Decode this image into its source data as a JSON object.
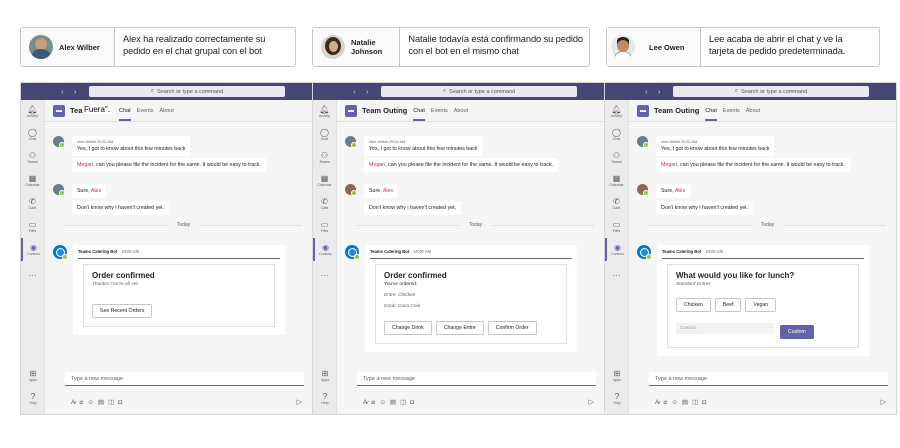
{
  "captions": [
    {
      "name": "Alex Wilber",
      "text_line1": "Alex ha realizado correctamente su",
      "text_line2": "pedido en el chat grupal con el bot"
    },
    {
      "name_line1": "Natalie",
      "name_line2": "Johnson",
      "text_line1": "Natalie todavía está confirmando su pedido",
      "text_line2": "con el bot en el mismo chat"
    },
    {
      "name": "Lee Owen",
      "text_line1": "Lee acaba de abrir el chat y ve la",
      "text_line2": "tarjeta de pedido predeterminada."
    }
  ],
  "shared": {
    "nav_arrows": "‹ ›",
    "search_placeholder": "Search or type a command",
    "rail": [
      "Activity",
      "Chat",
      "Teams",
      "Calendar",
      "Calls",
      "Files",
      "Contoso",
      "Apps",
      "Help"
    ],
    "tabs": [
      "Chat",
      "Events",
      "About"
    ],
    "msg1_meta": "Alex Wilber  09:32 AM",
    "msg1_line1": "Yes, I got to know about this few minutes back",
    "msg1_mention": "Megan",
    "msg1_line2": ", can you please file the incident for the same. It would be easy to track.",
    "msg2_prefix": "Sure, ",
    "msg2_mention": "Alex",
    "msg2_line2": "Don't know why i haven't created yet.",
    "today": "Today",
    "bot_name": "Teams Catering Bot",
    "bot_time": "10:00 AM",
    "compose_placeholder": "Type a new message"
  },
  "windows": [
    {
      "team": "Team",
      "overlay": "Fuera\".",
      "card_title": "Order confirmed",
      "card_sub": "Thanks! You're all set.",
      "button": "See Recent Orders"
    },
    {
      "team": "Team Outing",
      "card_title": "Order confirmed",
      "card_sub": "You've ordered:",
      "entre": "Entre: Chicken",
      "drink": "Drink: Coca Cola",
      "buttons": [
        "Change Drink",
        "Change Entre",
        "Confirm Order"
      ]
    },
    {
      "team": "Team Outing",
      "card_title": "What would you like for lunch?",
      "card_sub": "Standard Entres",
      "buttons": [
        "Chicken",
        "Beef",
        "Vegan"
      ],
      "custom_placeholder": "Custom",
      "custom_button": "Custom"
    }
  ]
}
